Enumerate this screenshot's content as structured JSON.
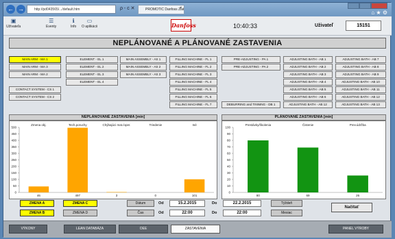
{
  "browser": {
    "url": "http://pd043565/.../default.htm",
    "tab_title": "PROMOTIC Danfoss Zlate",
    "addr_icons": "ρ - c ✕",
    "top_icons": "⌂ ★ ⚙"
  },
  "toolbar": {
    "items": [
      {
        "label": "Užívateľa",
        "icon": "user-icon"
      },
      {
        "label": "Eventy",
        "icon": "events-icon"
      },
      {
        "label": "Info",
        "icon": "info-icon"
      },
      {
        "label": "O aplikácii",
        "icon": "about-icon"
      }
    ],
    "logo": "Danfoss",
    "clock": "10:40:33",
    "user_label": "Uživateľ",
    "user_value": "15151"
  },
  "page_title": "NEPLÁNOVANÉ A PLÁNOVANÉ ZASTAVENIA",
  "machines": {
    "col1": [
      "MAIN ARM - MA 1",
      "MAIN ARM - MA 3",
      "MAIN ARM - MA 2",
      "",
      "CONTACT SYSTEM - CS 1",
      "CONTACT SYSTEM - CS 2"
    ],
    "col2": [
      "ELEMENT - EL 1",
      "ELEMENT - EL 2",
      "ELEMENT - EL 3",
      "ELEMENT - EL 4"
    ],
    "col3": [
      "MAIN ASSEMBLY - AS 1",
      "MAIN ASSEMBLY - AS 2",
      "MAIN ASSEMBLY - AS 3"
    ],
    "col4": [
      "FILLING MACHINE - FL 1",
      "FILLING MACHINE - FL 2",
      "FILLING MACHINE - FL 3",
      "FILLING MACHINE - FL 4",
      "FILLING MACHINE - FL 5",
      "FILLING MACHINE - FL 6",
      "FILLING MACHINE - FL 7"
    ],
    "col5": [
      "PRE-ADJUSTING - PA 1",
      "PRE-ADJUSTING - PA 2",
      "",
      "",
      "",
      "",
      "DEBURRING and TINNING - DB 1"
    ],
    "col6": [
      "ADJUSTING BATH - AB 1",
      "ADJUSTING BATH - AB 2",
      "ADJUSTING BATH - AB 3",
      "ADJUSTING BATH - AB 4",
      "ADJUSTING BATH - AB 5",
      "ADJUSTING BATH - AB 6",
      "ADJUSTING BATH - AB 12"
    ],
    "col7": [
      "ADJUSTING BATH - AB 7",
      "ADJUSTING BATH - AB 8",
      "ADJUSTING BATH - AB 9",
      "ADJUSTING BATH - AB 10",
      "ADJUSTING BATH - AB 11",
      "ADJUSTING BATH - AB 12",
      "ADJUSTING BATH - AB 13"
    ],
    "selected": "MAIN ARM - MA 1"
  },
  "chart_data": [
    {
      "type": "bar",
      "title": "NEPLÁNOVANÉ ZASTAVENIA [min]",
      "categories": [
        "Zmena obj.",
        "Tech.poruchy",
        "Chýbajúci mat./oper.",
        "Triedenie",
        "Iné"
      ],
      "values": [
        46,
        497,
        3,
        0,
        101
      ],
      "value_labels": [
        "46",
        "497",
        "3",
        "0",
        "101"
      ],
      "color": "#ffa500",
      "ylim": [
        0,
        500
      ],
      "yticks": [
        0,
        50,
        100,
        150,
        200,
        250,
        300,
        350,
        400,
        450,
        500
      ],
      "grid": false
    },
    {
      "type": "bar",
      "title": "PLÁNOVANÉ ZASTAVENIA [min]",
      "categories": [
        "Prestávky/školenia",
        "Čistenie",
        "Prev.údržba"
      ],
      "values": [
        80,
        69,
        26
      ],
      "value_labels": [
        "80",
        "69",
        "26"
      ],
      "color": "#129412",
      "ylim": [
        0,
        100
      ],
      "yticks": [
        0,
        10,
        20,
        30,
        40,
        50,
        60,
        70,
        80,
        90,
        100
      ],
      "grid": false
    }
  ],
  "filters": {
    "shifts": [
      "ZMENA A",
      "ZMENA C",
      "ZMENA B",
      "ZMENA D"
    ],
    "datum_label": "Dátum",
    "cas_label": "Čas",
    "od": "Od",
    "do": "Do",
    "date_from": "15.2.2015",
    "date_to": "22.2.2015",
    "time_from": "22:00",
    "time_to": "22:00",
    "week": "Týždeň",
    "month": "Mesiac",
    "load": "Načítať"
  },
  "footer": {
    "nav": [
      "VÝKONY",
      "LEAN DATABÁZA",
      "OEE",
      "ZASTAVENIA",
      "PANEL VÝROBY"
    ],
    "active": "ZASTAVENIA"
  }
}
